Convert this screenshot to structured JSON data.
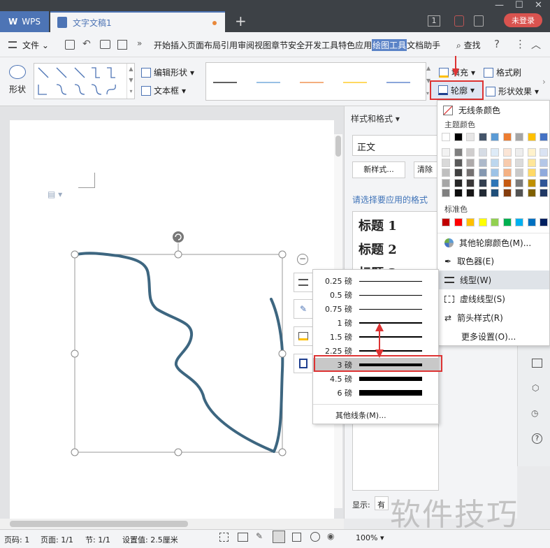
{
  "titlebar": {
    "app_tab": "WPS",
    "doc_tab": "文字文稿1",
    "badge": "1",
    "login": "未登录"
  },
  "menu": {
    "file": "文件",
    "items": [
      "开始",
      "插入",
      "页面布局",
      "引用",
      "审阅",
      "视图",
      "章节",
      "安全",
      "开发工具",
      "特色应用",
      "绘图工具",
      "文档助手"
    ],
    "active": "绘图工具",
    "search": "查找"
  },
  "ribbon": {
    "shape": "形状",
    "edit_shape": "编辑形状",
    "textbox": "文本框",
    "fill": "填充",
    "format_painter": "格式刷",
    "outline": "轮廓",
    "shape_effect": "形状效果",
    "line_colors": [
      "#000000",
      "#5b9bd5",
      "#ed7d31",
      "#ffc000",
      "#4472c4"
    ]
  },
  "styles_panel": {
    "header": "样式和格式",
    "current": "正文",
    "new_style": "新样式...",
    "clear": "清除",
    "prompt": "请选择要应用的格式",
    "styles": [
      "标题 1",
      "标题 2",
      "标题 3"
    ],
    "show_label": "显示:",
    "show_value": "有"
  },
  "outline_menu": {
    "no_color": "无线条颜色",
    "theme_title": "主题颜色",
    "theme_row": [
      "#ffffff",
      "#000000",
      "#e7e6e6",
      "#44546a",
      "#5b9bd5",
      "#ed7d31",
      "#a5a5a5",
      "#ffc000",
      "#4472c4"
    ],
    "theme_shades": [
      [
        "#f2f2f2",
        "#7f7f7f",
        "#d0cece",
        "#d6dce5",
        "#deebf7",
        "#fbe5d6",
        "#ededed",
        "#fff2cc",
        "#dae3f3"
      ],
      [
        "#d9d9d9",
        "#595959",
        "#aeaaaa",
        "#adb9ca",
        "#bdd7ee",
        "#f8cbad",
        "#dbdbdb",
        "#ffe699",
        "#b4c7e7"
      ],
      [
        "#bfbfbf",
        "#404040",
        "#757171",
        "#8497b0",
        "#9dc3e6",
        "#f4b183",
        "#c9c9c9",
        "#ffd966",
        "#8faadc"
      ],
      [
        "#a6a6a6",
        "#262626",
        "#3a3838",
        "#333f50",
        "#2e75b6",
        "#c55a11",
        "#7b7b7b",
        "#bf9000",
        "#2f5597"
      ],
      [
        "#7f7f7f",
        "#0d0d0d",
        "#171616",
        "#222a35",
        "#1f4e79",
        "#843c0c",
        "#525252",
        "#7f6000",
        "#203864"
      ]
    ],
    "std_title": "标准色",
    "std_colors": [
      "#c00000",
      "#ff0000",
      "#ffc000",
      "#ffff00",
      "#92d050",
      "#00b050",
      "#00b0f0",
      "#0070c0",
      "#002060"
    ],
    "more_colors": "其他轮廓颜色(M)...",
    "eyedropper": "取色器(E)",
    "line_type": "线型(W)",
    "dash_type": "虚线线型(S)",
    "arrow_style": "箭头样式(R)",
    "more_settings": "更多设置(O)..."
  },
  "weight_menu": {
    "items": [
      {
        "label": "0.25 磅",
        "pt": 0.25
      },
      {
        "label": "0.5 磅",
        "pt": 0.5
      },
      {
        "label": "0.75 磅",
        "pt": 0.75
      },
      {
        "label": "1 磅",
        "pt": 1
      },
      {
        "label": "1.5 磅",
        "pt": 1.5
      },
      {
        "label": "2.25 磅",
        "pt": 2.25
      },
      {
        "label": "3 磅",
        "pt": 3
      },
      {
        "label": "4.5 磅",
        "pt": 4.5
      },
      {
        "label": "6 磅",
        "pt": 6
      }
    ],
    "selected": "3 磅",
    "more_lines": "其他线条(M)..."
  },
  "status": {
    "page_no": "页码: 1",
    "pages": "页面: 1/1",
    "section": "节: 1/1",
    "setting": "设置值: 2.5厘米",
    "zoom": "100%"
  },
  "watermark": "软件技巧",
  "colors": {
    "accent": "#4d74b5",
    "highlight_box": "#dd3333",
    "curve": "#3d6680"
  }
}
